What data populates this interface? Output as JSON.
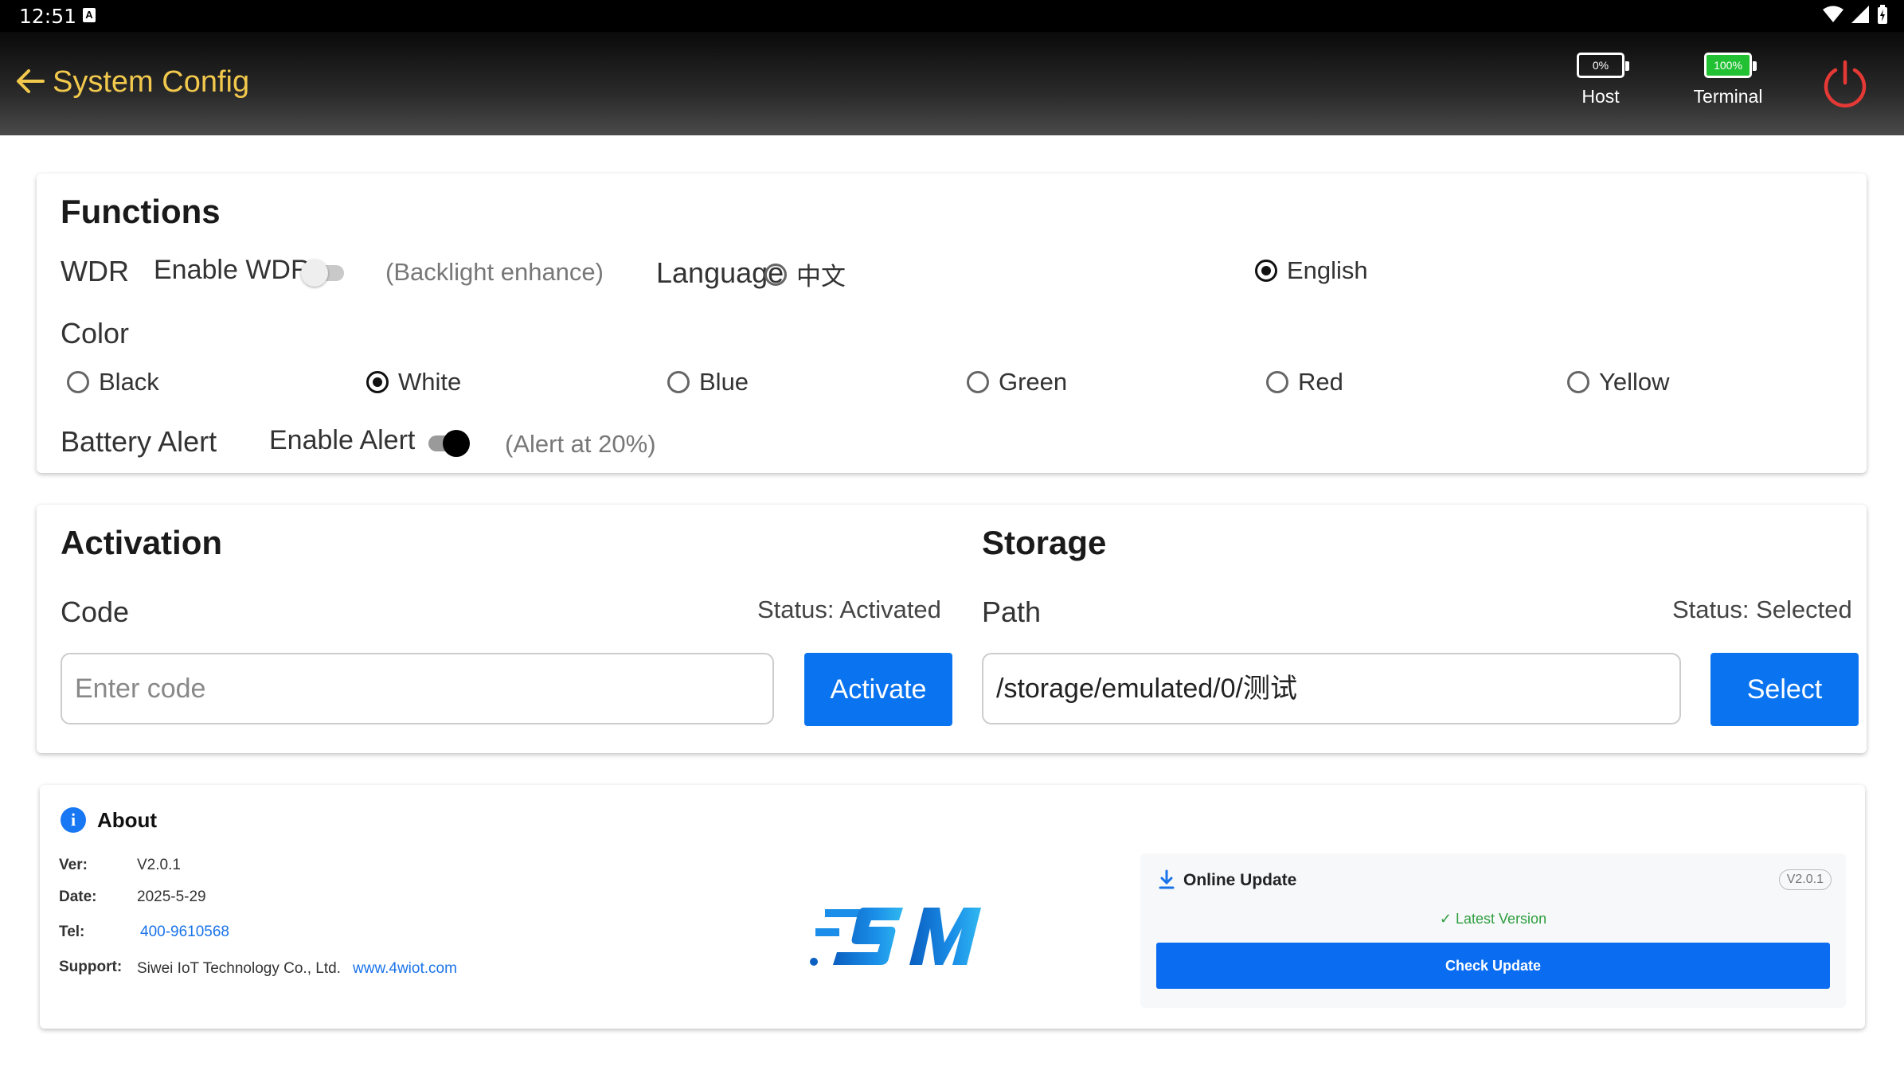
{
  "status_bar": {
    "time": "12:51",
    "notification_letter": "A"
  },
  "header": {
    "title": "System Config",
    "host": {
      "label": "Host",
      "percent": "0%"
    },
    "terminal": {
      "label": "Terminal",
      "percent": "100%"
    },
    "accent_color": "#f2c94c",
    "power_color": "#e53935"
  },
  "functions": {
    "title": "Functions",
    "wdr": {
      "label": "WDR",
      "toggle_label": "Enable WDR",
      "enabled": false,
      "hint": "(Backlight enhance)"
    },
    "language": {
      "label": "Language",
      "options": [
        "中文",
        "English"
      ],
      "selected": "English"
    },
    "color": {
      "label": "Color",
      "options": [
        "Black",
        "White",
        "Blue",
        "Green",
        "Red",
        "Yellow"
      ],
      "selected": "White"
    },
    "battery_alert": {
      "label": "Battery Alert",
      "toggle_label": "Enable Alert",
      "enabled": true,
      "hint": "(Alert at 20%)"
    }
  },
  "activation": {
    "title": "Activation",
    "code_label": "Code",
    "status": "Status: Activated",
    "placeholder": "Enter code",
    "button": "Activate"
  },
  "storage": {
    "title": "Storage",
    "path_label": "Path",
    "status": "Status: Selected",
    "value": "/storage/emulated/0/测试",
    "button": "Select"
  },
  "about": {
    "title": "About",
    "ver_key": "Ver:",
    "ver": "V2.0.1",
    "date_key": "Date:",
    "date": "2025-5-29",
    "tel_key": "Tel:",
    "tel": "400-9610568",
    "support_key": "Support:",
    "support": "Siwei IoT Technology Co., Ltd.",
    "website": "www.4wiot.com",
    "update": {
      "title": "Online Update",
      "version_badge": "V2.0.1",
      "latest": "✓ Latest Version",
      "button": "Check Update"
    }
  },
  "icons": {
    "back": "arrow-left-icon",
    "power": "power-icon",
    "info": "info-icon",
    "download": "download-icon"
  }
}
